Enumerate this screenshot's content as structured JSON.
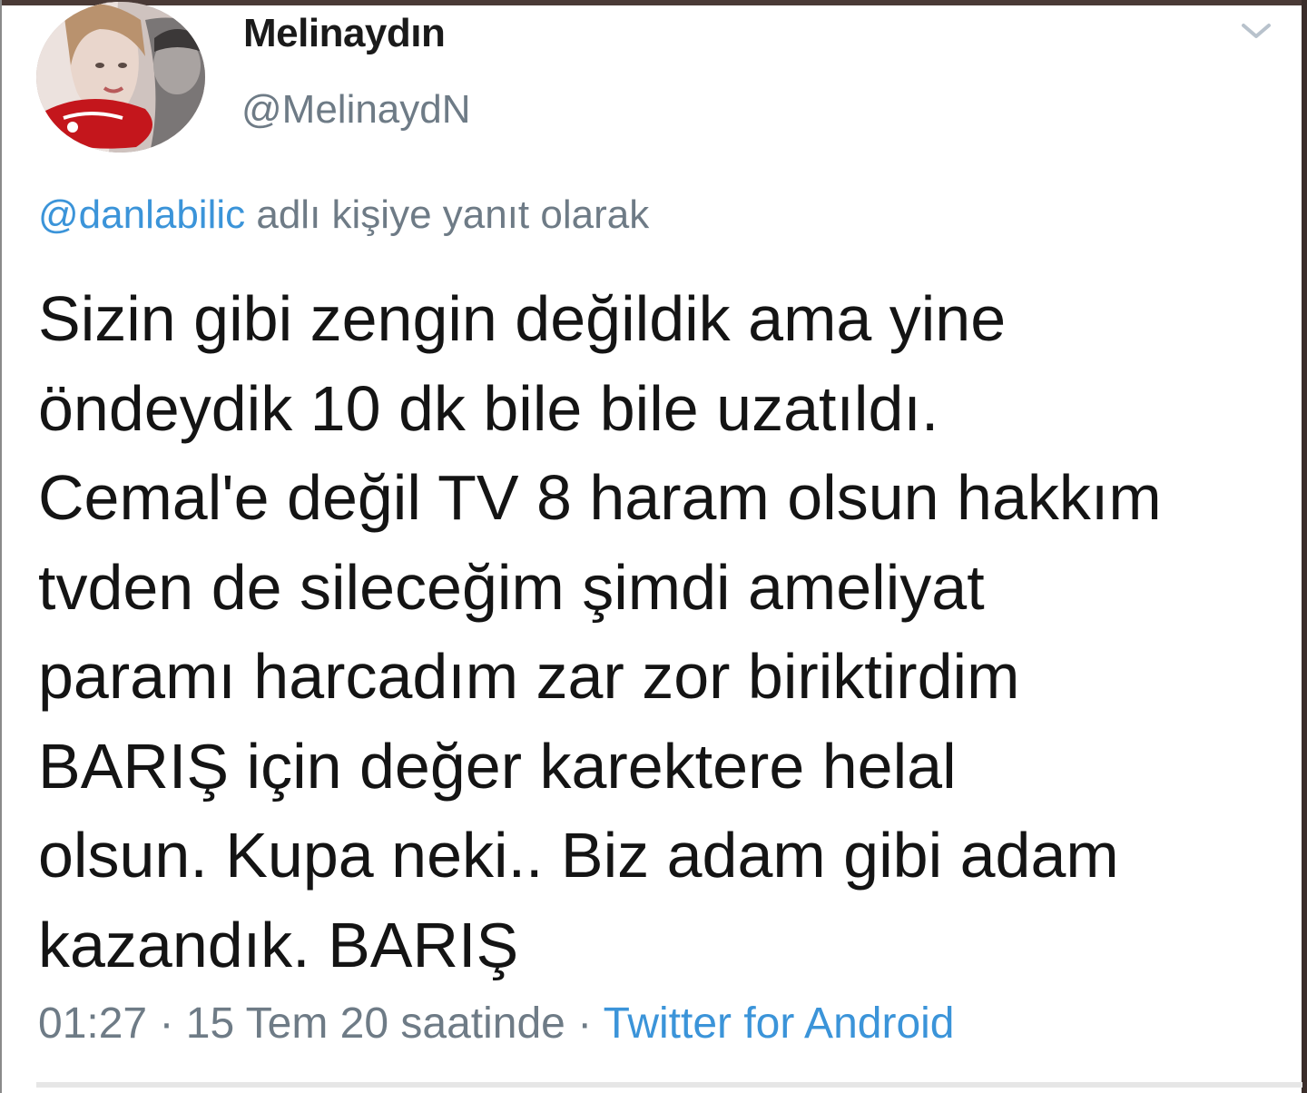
{
  "user": {
    "display_name": "Melinaydın",
    "handle": "@MelinaydN"
  },
  "reply": {
    "mention": "@danlabilic",
    "suffix": " adlı kişiye yanıt olarak"
  },
  "tweet": {
    "text": "Sizin gibi zengin değildik ama yine\nöndeydik 10 dk bile bile uzatıldı.\nCemal'e değil TV 8 haram olsun hakkım\ntvden de sileceğim şimdi  ameliyat\nparamı harcadım zar zor biriktirdim\nBARIŞ için değer karektere helal\nolsun. Kupa neki.. Biz adam gibi adam\nkazandık. BARIŞ"
  },
  "meta": {
    "time": "01:27",
    "sep1": " · ",
    "date": "15 Tem 20 saatinde",
    "sep2": " · ",
    "source": "Twitter for Android"
  },
  "icons": {
    "menu": "chevron-down-icon"
  },
  "colors": {
    "link": "#3b94d9",
    "secondary_text": "#6e7b86",
    "primary_text": "#141414"
  }
}
